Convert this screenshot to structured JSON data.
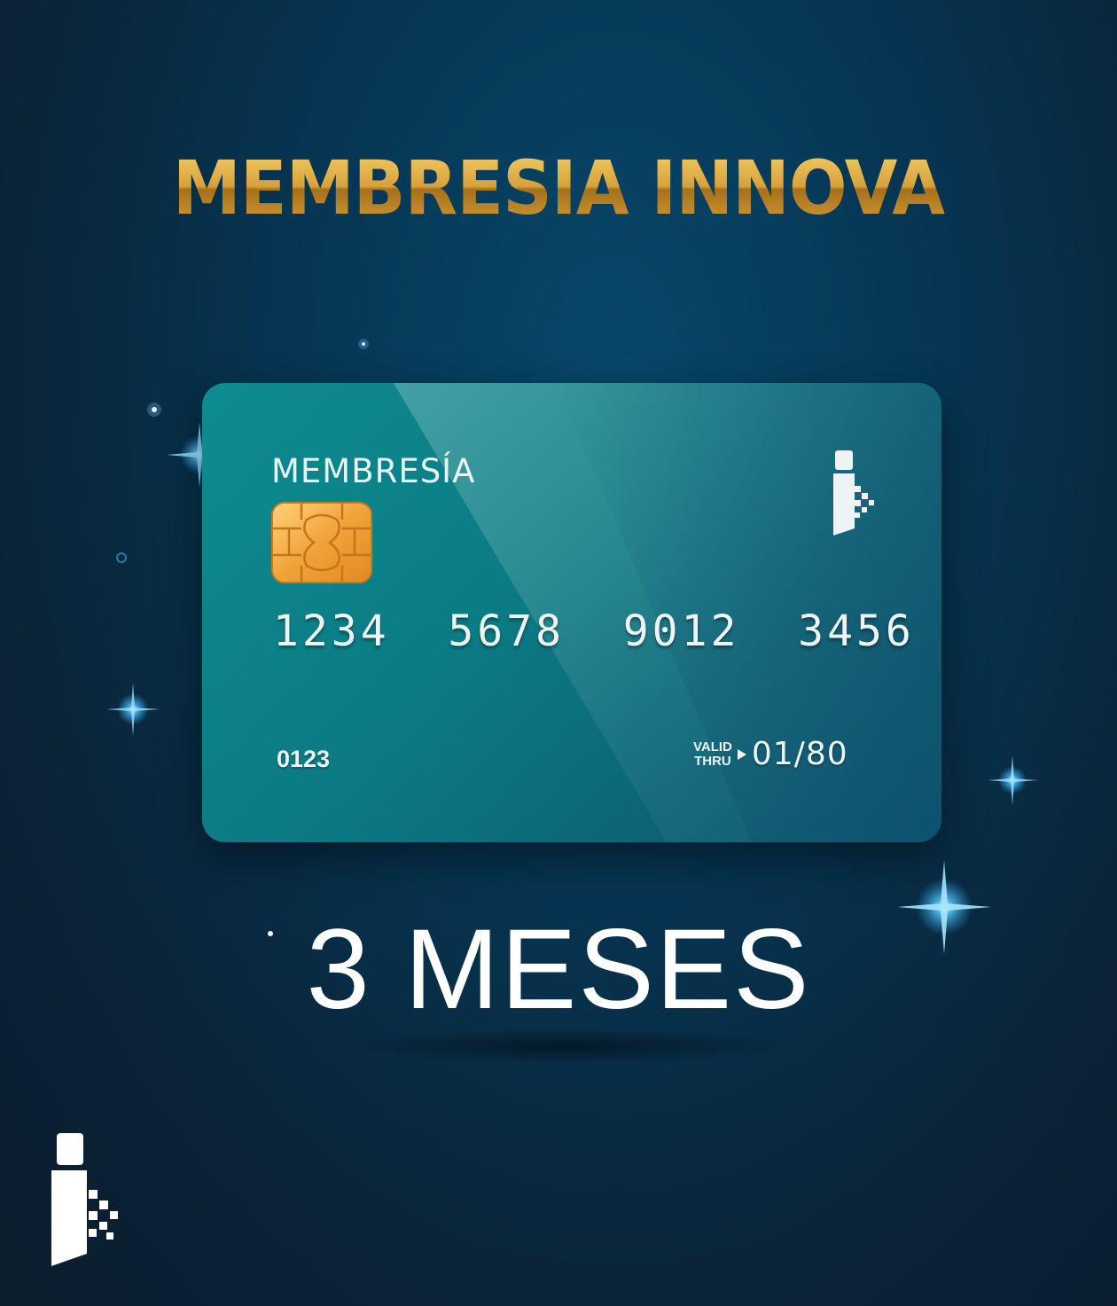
{
  "headline": "MEMBRESIA INNOVA",
  "card": {
    "label": "MEMBRESÍA",
    "number": "1234  5678  9012  3456",
    "code": "0123",
    "valid_line1": "VALID",
    "valid_line2": "THRU",
    "valid_date": "01/80"
  },
  "duration": "3 MESES",
  "colors": {
    "background": "#0a2a40",
    "headline_gold": "#d7a13c",
    "card_teal": "#0b7a83",
    "chip_gold": "#f0a83a",
    "text_white": "#ffffff",
    "sparkle": "#58c8ff"
  },
  "icons": {
    "card_logo": "innova-logo-icon",
    "chip": "emv-chip-icon",
    "brand_logo": "innova-logo-icon"
  }
}
